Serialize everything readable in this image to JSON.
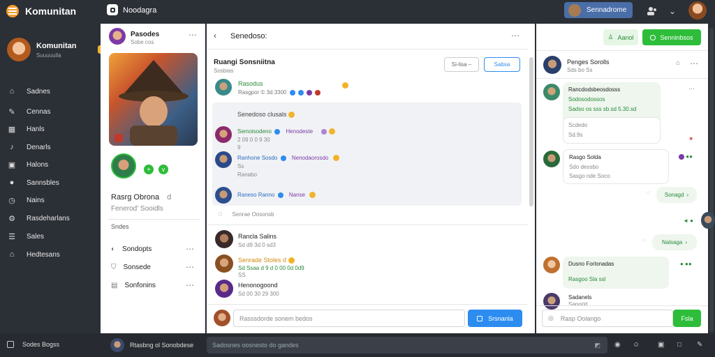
{
  "app": {
    "name": "Komunitan",
    "tab_label": "Noodagra"
  },
  "header": {
    "search_pill": "Sennadrome"
  },
  "sidebar": {
    "profile_name": "Komunitan",
    "profile_sub": "Suuuuulla",
    "items": [
      {
        "label": "Sadnes",
        "icon": "home-icon"
      },
      {
        "label": "Cennas",
        "icon": "pen-icon"
      },
      {
        "label": "Hanls",
        "icon": "grid-icon"
      },
      {
        "label": "Denarls",
        "icon": "music-icon"
      },
      {
        "label": "Halons",
        "icon": "calendar-icon"
      },
      {
        "label": "Sannsbles",
        "icon": "circle-icon"
      },
      {
        "label": "Nains",
        "icon": "clock-icon"
      },
      {
        "label": "Rasdeharlans",
        "icon": "settings-icon"
      },
      {
        "label": "Sales",
        "icon": "list-icon"
      },
      {
        "label": "Hedtesans",
        "icon": "home2-icon"
      }
    ],
    "footer": "Sodes Bogss"
  },
  "profile_col": {
    "title": "Pasodes",
    "subtitle": "Sobe cos",
    "name": "Rasrg Obrona",
    "name_suffix": "d",
    "desc": "Fenerod' Sooidls",
    "section": "Sndes",
    "links": [
      "Sondopts",
      "Sonsede",
      "Sonfonins"
    ],
    "badge_a": "+",
    "badge_b": "v"
  },
  "chat": {
    "title": "Senedoso:",
    "group_name": "Ruangi Sonsniitna",
    "group_sub": "Sosbias",
    "pill": "Si-lisa –",
    "pill2": "Sabsa",
    "post_name": "Rasodus",
    "post_meta": "Rasgpor © 3d.3300",
    "messages": [
      {
        "text": "Senedoso clusals"
      },
      {
        "name": "Semoisodeno",
        "tag": "Henodeste",
        "l1": "2 09 0 0 9 30",
        "l2": "9"
      },
      {
        "name": "Ranhone Sosdo",
        "tag": "Nenodaorosdo",
        "l1": "Ss",
        "l2": "Ranabo"
      },
      {
        "name": "Raneso Ranno",
        "tag": "Nanse"
      }
    ],
    "compose_hint": "Senrae Oosonsb",
    "list": [
      {
        "name": "Rancla Salins",
        "meta": "Sd d9 3d 0 sd3"
      },
      {
        "name": "Senrade Stoles d",
        "meta": "Sd Ssaa d 9 d 0 00 0d 0d9",
        "sub": "SS"
      },
      {
        "name": "Henonogoond",
        "meta": "Sd 00 30 29 300"
      }
    ],
    "input_placeholder": "Rasssdorde sonem bedos",
    "send_label": "Srsnanla"
  },
  "right": {
    "btn_a": "Aanol",
    "btn_b": "Senninbsos",
    "title": "Penges Sorolls",
    "sub": "Sds bo Ss",
    "msgs": [
      {
        "name": "Rancdodsbeosdosss",
        "l1": "Sodosodossos",
        "l2": "Sadso os sss sb.sd 5.30.sd",
        "l3": "Scdedo",
        "l4": "Sd.9s"
      },
      {
        "name": "Rasgo Solda",
        "l1": "Sdo dessbo",
        "l2": "Sasgo nde Soco"
      },
      {
        "name": "Dusno Forlonadas",
        "l1": "Rasgoo Sla ssl"
      },
      {
        "name": "Sadanels",
        "l1": "Sanorld"
      }
    ],
    "reply1": "Sonagd",
    "reply2": "Nalsaga",
    "input_placeholder": "Rasp Oolango",
    "send_label": "Fsla"
  },
  "bottombar": {
    "user": "Rtasbng ol Sonobdese",
    "search_placeholder": "Sadosnes oosnesto do gandes"
  }
}
